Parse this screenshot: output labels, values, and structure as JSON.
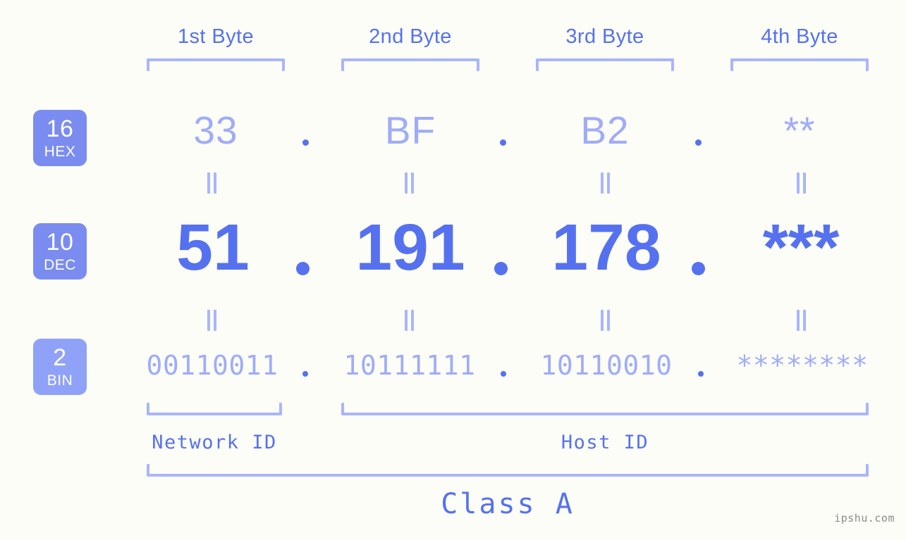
{
  "byte_headers": [
    {
      "label": "1st Byte"
    },
    {
      "label": "2nd Byte"
    },
    {
      "label": "3rd Byte"
    },
    {
      "label": "4th Byte"
    }
  ],
  "radix_badges": [
    {
      "number": "16",
      "abbr": "HEX"
    },
    {
      "number": "10",
      "abbr": "DEC"
    },
    {
      "number": "2",
      "abbr": "BIN"
    }
  ],
  "rows": {
    "hex": {
      "values": [
        "33",
        "BF",
        "B2",
        "**"
      ]
    },
    "dec": {
      "values": [
        "51",
        "191",
        "178",
        "***"
      ]
    },
    "bin": {
      "values": [
        "00110011",
        "10111111",
        "10110010",
        "********"
      ]
    }
  },
  "separator": ".",
  "equals_symbol": "||",
  "segments": {
    "network_id": "Network ID",
    "host_id": "Host ID",
    "class": "Class A"
  },
  "watermark": "ipshu.com",
  "colors": {
    "background": "#fbfdf6",
    "accent_strong": "#5671f0",
    "accent_light": "#a0acf8",
    "bracket": "#aab5fb",
    "badge": "#7b8cf0",
    "badge_bin": "#8fa2f7",
    "watermark": "#8c8c8c"
  }
}
